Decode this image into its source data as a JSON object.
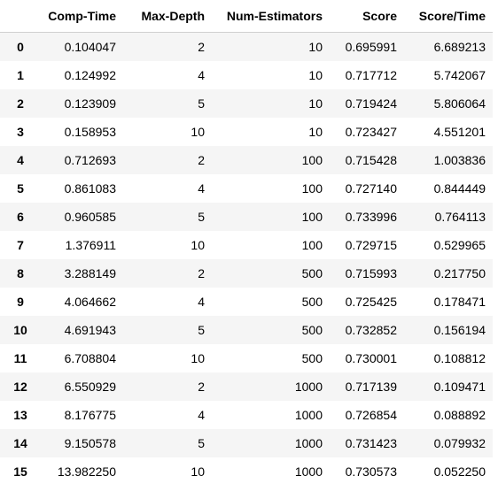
{
  "table": {
    "columns": [
      "",
      "Comp-Time",
      "Max-Depth",
      "Num-Estimators",
      "Score",
      "Score/Time"
    ],
    "rows": [
      {
        "index": "0",
        "cells": [
          "0.104047",
          "2",
          "10",
          "0.695991",
          "6.689213"
        ]
      },
      {
        "index": "1",
        "cells": [
          "0.124992",
          "4",
          "10",
          "0.717712",
          "5.742067"
        ]
      },
      {
        "index": "2",
        "cells": [
          "0.123909",
          "5",
          "10",
          "0.719424",
          "5.806064"
        ]
      },
      {
        "index": "3",
        "cells": [
          "0.158953",
          "10",
          "10",
          "0.723427",
          "4.551201"
        ]
      },
      {
        "index": "4",
        "cells": [
          "0.712693",
          "2",
          "100",
          "0.715428",
          "1.003836"
        ]
      },
      {
        "index": "5",
        "cells": [
          "0.861083",
          "4",
          "100",
          "0.727140",
          "0.844449"
        ]
      },
      {
        "index": "6",
        "cells": [
          "0.960585",
          "5",
          "100",
          "0.733996",
          "0.764113"
        ]
      },
      {
        "index": "7",
        "cells": [
          "1.376911",
          "10",
          "100",
          "0.729715",
          "0.529965"
        ]
      },
      {
        "index": "8",
        "cells": [
          "3.288149",
          "2",
          "500",
          "0.715993",
          "0.217750"
        ]
      },
      {
        "index": "9",
        "cells": [
          "4.064662",
          "4",
          "500",
          "0.725425",
          "0.178471"
        ]
      },
      {
        "index": "10",
        "cells": [
          "4.691943",
          "5",
          "500",
          "0.732852",
          "0.156194"
        ]
      },
      {
        "index": "11",
        "cells": [
          "6.708804",
          "10",
          "500",
          "0.730001",
          "0.108812"
        ]
      },
      {
        "index": "12",
        "cells": [
          "6.550929",
          "2",
          "1000",
          "0.717139",
          "0.109471"
        ]
      },
      {
        "index": "13",
        "cells": [
          "8.176775",
          "4",
          "1000",
          "0.726854",
          "0.088892"
        ]
      },
      {
        "index": "14",
        "cells": [
          "9.150578",
          "5",
          "1000",
          "0.731423",
          "0.079932"
        ]
      },
      {
        "index": "15",
        "cells": [
          "13.982250",
          "10",
          "1000",
          "0.730573",
          "0.052250"
        ]
      }
    ]
  }
}
